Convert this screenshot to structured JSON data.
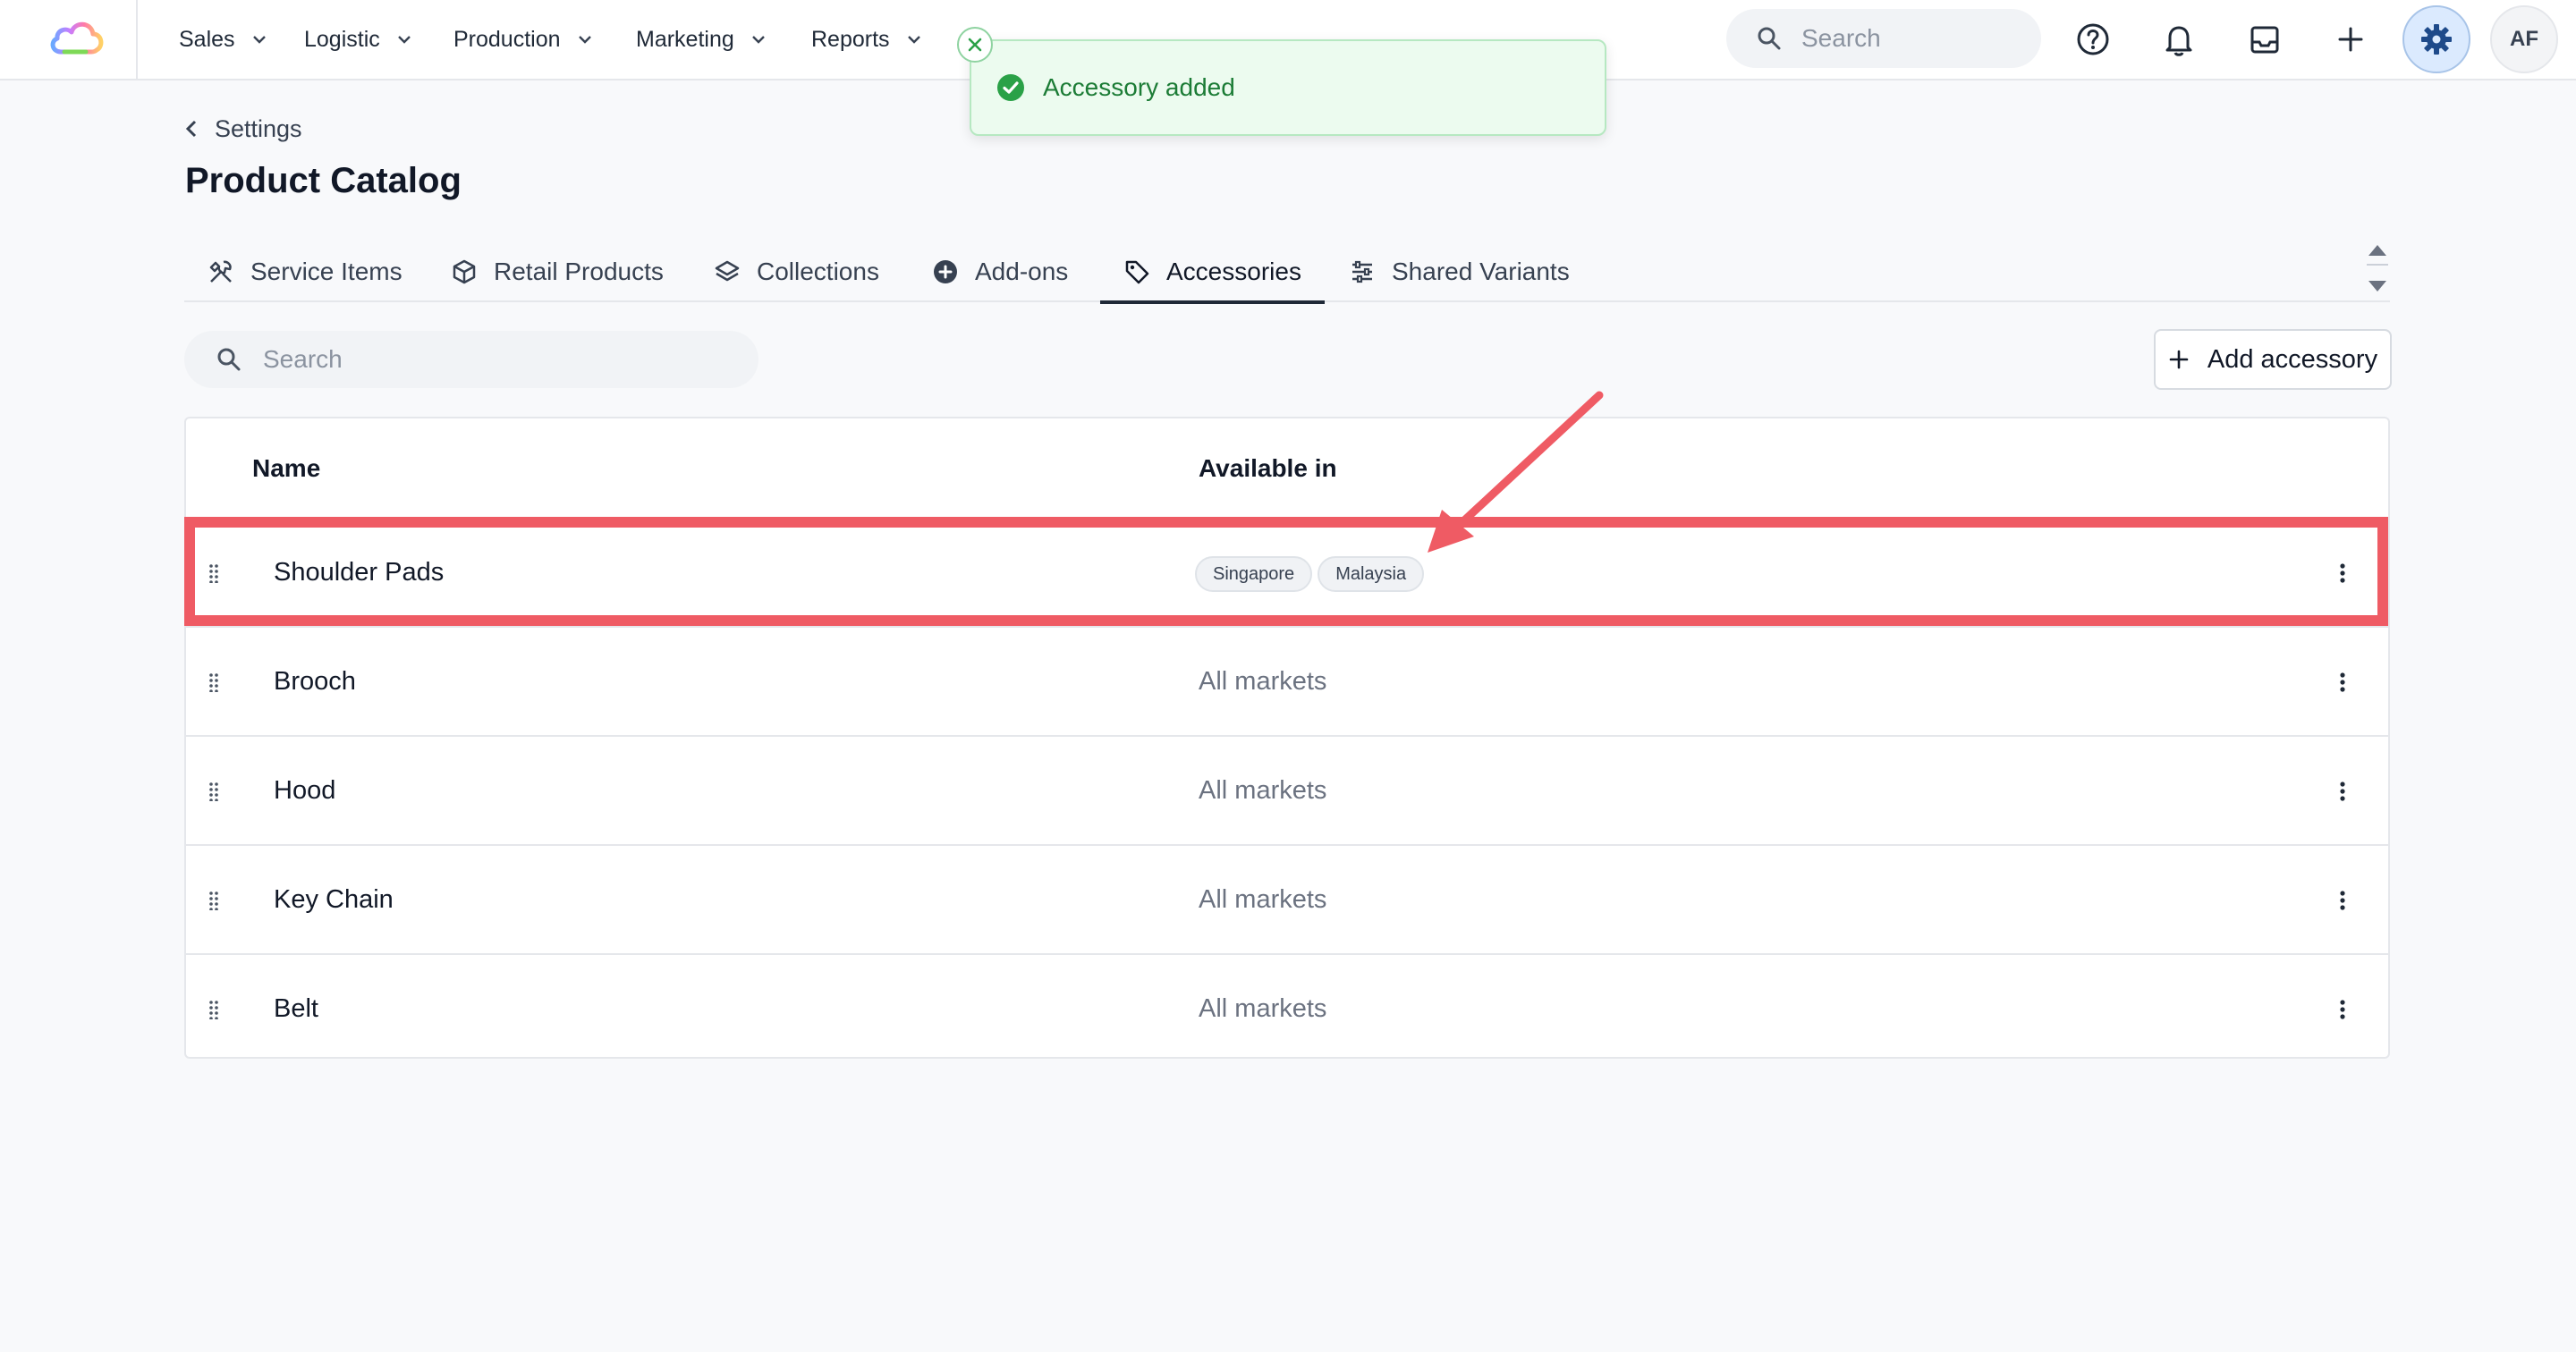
{
  "nav": {
    "items": [
      {
        "label": "Sales"
      },
      {
        "label": "Logistic"
      },
      {
        "label": "Production"
      },
      {
        "label": "Marketing"
      },
      {
        "label": "Reports"
      }
    ],
    "search_placeholder": "Search",
    "avatar_initials": "AF",
    "icons": [
      "help-icon",
      "bell-icon",
      "inbox-icon",
      "plus-icon",
      "gear-icon"
    ]
  },
  "toast": {
    "message": "Accessory added",
    "color": "#1c7c36"
  },
  "breadcrumb": {
    "label": "Settings"
  },
  "page": {
    "title": "Product Catalog"
  },
  "tabs": [
    {
      "label": "Service Items",
      "icon": "tools-icon"
    },
    {
      "label": "Retail Products",
      "icon": "box-icon"
    },
    {
      "label": "Collections",
      "icon": "layers-icon"
    },
    {
      "label": "Add-ons",
      "icon": "plus-circle-icon"
    },
    {
      "label": "Accessories",
      "icon": "tag-icon",
      "active": true
    },
    {
      "label": "Shared Variants",
      "icon": "sliders-icon"
    }
  ],
  "toolbar": {
    "search_placeholder": "Search",
    "add_label": "Add accessory"
  },
  "table": {
    "headers": {
      "name": "Name",
      "available": "Available in"
    },
    "rows": [
      {
        "name": "Shoulder Pads",
        "chips": [
          "Singapore",
          "Malaysia"
        ]
      },
      {
        "name": "Brooch",
        "available": "All markets"
      },
      {
        "name": "Hood",
        "available": "All markets"
      },
      {
        "name": "Key Chain",
        "available": "All markets"
      },
      {
        "name": "Belt",
        "available": "All markets"
      }
    ]
  },
  "colors": {
    "accent": "#1e4a8a",
    "highlight": "#ef5b64",
    "success": "#2aa147"
  }
}
